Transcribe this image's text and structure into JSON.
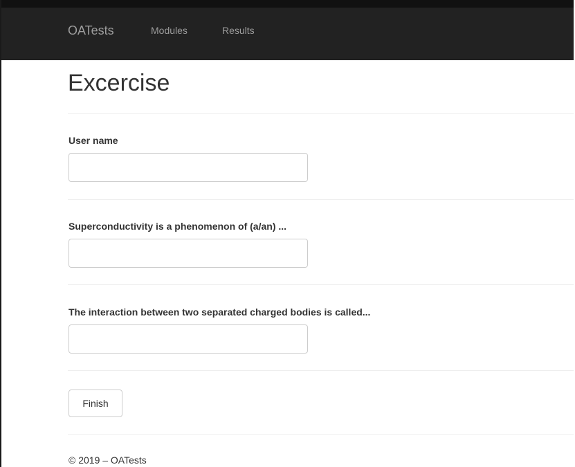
{
  "navbar": {
    "brand": "OATests",
    "links": [
      "Modules",
      "Results"
    ]
  },
  "page": {
    "title": "Excercise"
  },
  "form": {
    "fields": [
      {
        "label": "User name",
        "value": ""
      },
      {
        "label": "Superconductivity is a phenomenon of (a/an) ...",
        "value": ""
      },
      {
        "label": "The interaction between two separated charged bodies is called...",
        "value": ""
      }
    ],
    "submit_label": "Finish"
  },
  "footer": {
    "text": "© 2019 – OATests"
  }
}
